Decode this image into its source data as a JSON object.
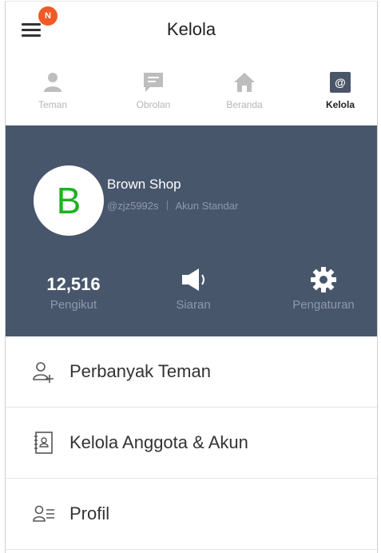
{
  "header": {
    "title": "Kelola",
    "badge": "N",
    "menu_icon": "hamburger-menu-icon"
  },
  "tabs": [
    {
      "label": "Teman",
      "icon": "person-icon"
    },
    {
      "label": "Obrolan",
      "icon": "chat-bubble-icon"
    },
    {
      "label": "Beranda",
      "icon": "home-icon"
    },
    {
      "label": "Kelola",
      "icon": "at-sign-icon"
    }
  ],
  "profile": {
    "avatar_letter": "B",
    "name": "Brown Shop",
    "handle": "@zjz5992s",
    "account_type": "Akun Standar"
  },
  "stats": {
    "followers_count": "12,516",
    "followers_label": "Pengikut",
    "broadcast_label": "Siaran",
    "settings_label": "Pengaturan"
  },
  "menu": [
    {
      "label": "Perbanyak Teman",
      "icon": "add-friend-icon"
    },
    {
      "label": "Kelola Anggota & Akun",
      "icon": "contact-book-icon"
    },
    {
      "label": "Profil",
      "icon": "profile-card-icon"
    }
  ],
  "colors": {
    "panel": "#48566c",
    "badge": "#f15a22",
    "avatar_letter": "#1fb11f"
  }
}
